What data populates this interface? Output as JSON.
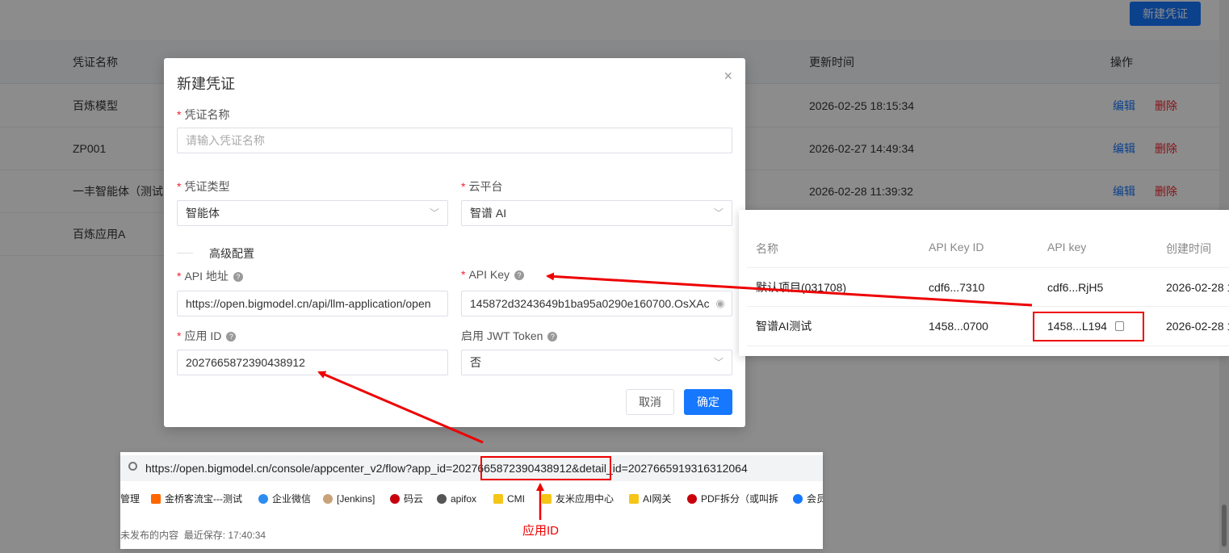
{
  "page": {
    "new_button": "新建凭证",
    "columns": [
      "凭证名称",
      "更新时间",
      "操作"
    ],
    "rows": [
      {
        "name": "百炼模型",
        "updated": "2026-02-25 18:15:34",
        "edit": "编辑",
        "delete": "删除"
      },
      {
        "name": "ZP001",
        "updated": "2026-02-27 14:49:34",
        "edit": "编辑",
        "delete": "删除"
      },
      {
        "name": "一丰智能体（测试",
        "updated": "2026-02-28 11:39:32",
        "edit": "编辑",
        "delete": "删除"
      },
      {
        "name": "百炼应用A",
        "updated": "",
        "edit": "",
        "delete": ""
      }
    ]
  },
  "dialog": {
    "title": "新建凭证",
    "close_icon": "×",
    "name_label": "凭证名称",
    "name_placeholder": "请输入凭证名称",
    "type_label": "凭证类型",
    "type_value": "智能体",
    "cloud_label": "云平台",
    "cloud_value": "智谱 AI",
    "advanced_label": "高级配置",
    "api_addr_label": "API 地址",
    "api_addr_value": "https://open.bigmodel.cn/api/llm-application/open",
    "api_key_label": "API Key",
    "api_key_value": "145872d3243649b1ba95a0290e160700.OsXAc",
    "app_id_label": "应用 ID",
    "app_id_value": "2027665872390438912",
    "jwt_label": "启用 JWT Token",
    "jwt_value": "否",
    "cancel": "取消",
    "ok": "确定"
  },
  "api_panel": {
    "headers": [
      "名称",
      "API Key ID",
      "API key",
      "创建时间"
    ],
    "rows": [
      {
        "name": "默认项目(031708)",
        "key_id": "cdf6...7310",
        "key": "cdf6...RjH5",
        "created": "2026-02-28 1"
      },
      {
        "name": "智谱AI测试",
        "key_id": "1458...0700",
        "key": "1458...L194",
        "created": "2026-02-28 1"
      }
    ]
  },
  "browser": {
    "url_prefix": "https://open.bigmodel.cn/console/appcenter_v2/flow?app_id=",
    "url_app_id": "2027665872390438912",
    "url_suffix": "&detail_id=2027665919316312064",
    "bookmarks": [
      "管理",
      "金桥客流宝---测试",
      "企业微信",
      "[Jenkins]",
      "码云",
      "apifox",
      "CMI",
      "友米应用中心",
      "AI网关",
      "PDF拆分（或叫拆",
      "会员"
    ],
    "status_unpublished": "未发布的内容",
    "status_saved": "最近保存: 17:40:34"
  },
  "annotation": "应用ID",
  "colors": {
    "primary": "#1677ff",
    "danger": "#f5222d",
    "annotation": "#e00000"
  }
}
